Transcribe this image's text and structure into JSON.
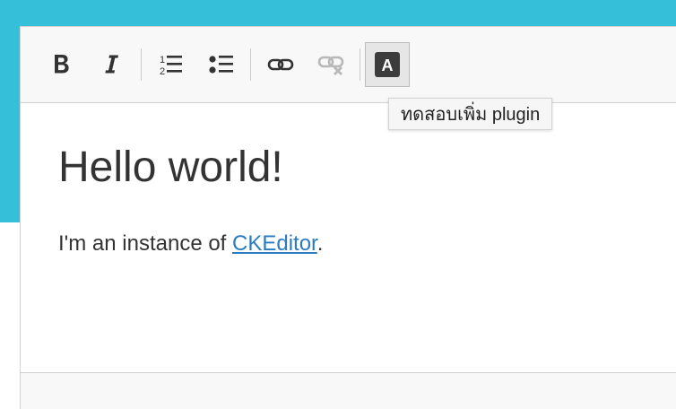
{
  "colors": {
    "accent": "#35bfd8",
    "link": "#2a7bbf",
    "text": "#333333",
    "toolbar_bg": "#f8f8f8"
  },
  "toolbar": {
    "items": [
      {
        "name": "bold",
        "icon": "bold-icon",
        "state": "normal"
      },
      {
        "name": "italic",
        "icon": "italic-icon",
        "state": "normal"
      },
      {
        "name": "numbered-list",
        "icon": "numbered-list-icon",
        "state": "normal"
      },
      {
        "name": "bulleted-list",
        "icon": "bulleted-list-icon",
        "state": "normal"
      },
      {
        "name": "link",
        "icon": "link-icon",
        "state": "normal"
      },
      {
        "name": "unlink",
        "icon": "unlink-icon",
        "state": "disabled"
      },
      {
        "name": "plugin",
        "icon": "plugin-a-icon",
        "state": "active",
        "glyph": "A"
      }
    ]
  },
  "tooltip": {
    "text": "ทดสอบเพิ่ม plugin"
  },
  "content": {
    "heading": "Hello world!",
    "paragraph_before": "I'm an instance of ",
    "link_text": "CKEditor",
    "paragraph_after": "."
  }
}
